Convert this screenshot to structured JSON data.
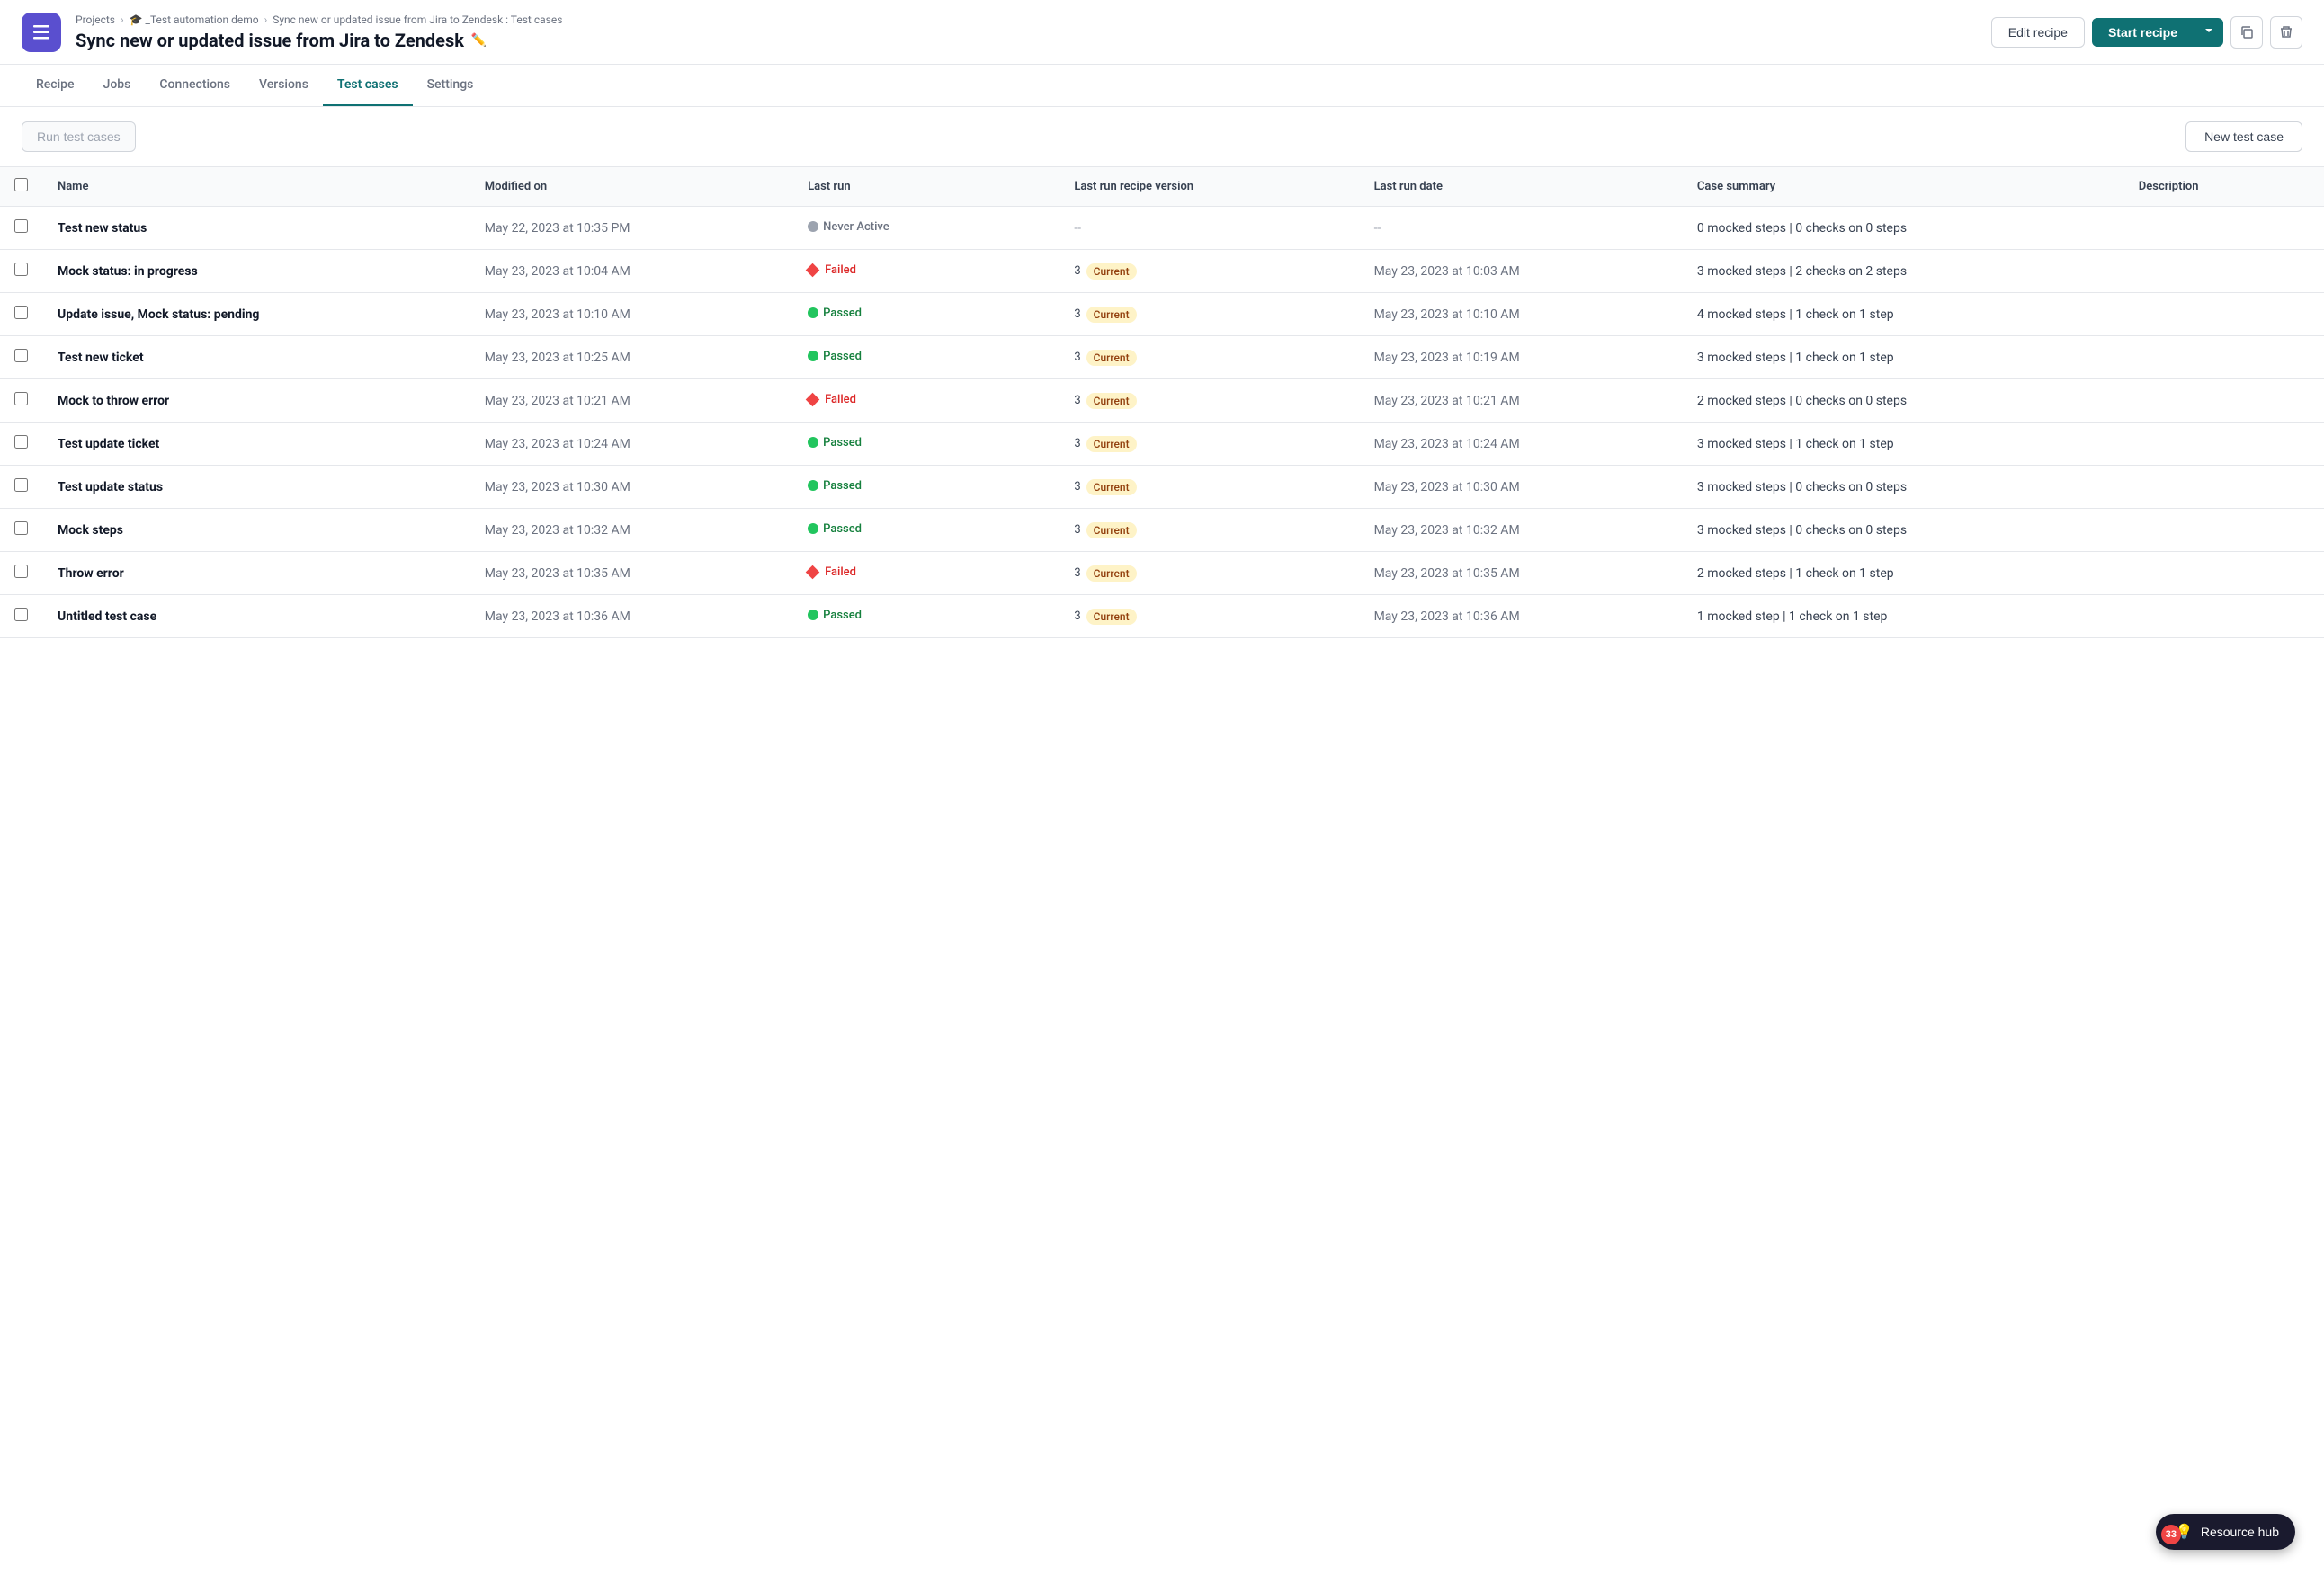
{
  "breadcrumb": {
    "items": [
      "Projects",
      "_Test automation demo",
      "Sync new or updated issue from Jira to Zendesk : Test cases"
    ]
  },
  "header": {
    "title": "Sync new or updated issue from Jira to Zendesk",
    "edit_recipe_label": "Edit recipe",
    "start_recipe_label": "Start recipe"
  },
  "nav": {
    "tabs": [
      "Recipe",
      "Jobs",
      "Connections",
      "Versions",
      "Test cases",
      "Settings"
    ],
    "active": "Test cases"
  },
  "toolbar": {
    "run_test_label": "Run test cases",
    "new_test_label": "New test case"
  },
  "table": {
    "columns": [
      "Name",
      "Modified on",
      "Last run",
      "Last run recipe version",
      "Last run date",
      "Case summary",
      "Description"
    ],
    "rows": [
      {
        "name": "Test new status",
        "modified_on": "May 22, 2023 at 10:35 PM",
        "last_run_status": "never",
        "last_run_label": "Never Active",
        "version_num": "--",
        "version_tag": "",
        "last_run_date": "--",
        "case_summary": "0 mocked steps | 0 checks on 0 steps",
        "description": ""
      },
      {
        "name": "Mock status: in progress",
        "modified_on": "May 23, 2023 at 10:04 AM",
        "last_run_status": "failed",
        "last_run_label": "Failed",
        "version_num": "3",
        "version_tag": "Current",
        "last_run_date": "May 23, 2023 at 10:03 AM",
        "case_summary": "3 mocked steps | 2 checks on 2 steps",
        "description": ""
      },
      {
        "name": "Update issue, Mock status: pending",
        "modified_on": "May 23, 2023 at 10:10 AM",
        "last_run_status": "passed",
        "last_run_label": "Passed",
        "version_num": "3",
        "version_tag": "Current",
        "last_run_date": "May 23, 2023 at 10:10 AM",
        "case_summary": "4 mocked steps | 1 check on 1 step",
        "description": ""
      },
      {
        "name": "Test new ticket",
        "modified_on": "May 23, 2023 at 10:25 AM",
        "last_run_status": "passed",
        "last_run_label": "Passed",
        "version_num": "3",
        "version_tag": "Current",
        "last_run_date": "May 23, 2023 at 10:19 AM",
        "case_summary": "3 mocked steps | 1 check on 1 step",
        "description": ""
      },
      {
        "name": "Mock to throw error",
        "modified_on": "May 23, 2023 at 10:21 AM",
        "last_run_status": "failed",
        "last_run_label": "Failed",
        "version_num": "3",
        "version_tag": "Current",
        "last_run_date": "May 23, 2023 at 10:21 AM",
        "case_summary": "2 mocked steps | 0 checks on 0 steps",
        "description": ""
      },
      {
        "name": "Test update ticket",
        "modified_on": "May 23, 2023 at 10:24 AM",
        "last_run_status": "passed",
        "last_run_label": "Passed",
        "version_num": "3",
        "version_tag": "Current",
        "last_run_date": "May 23, 2023 at 10:24 AM",
        "case_summary": "3 mocked steps | 1 check on 1 step",
        "description": ""
      },
      {
        "name": "Test update status",
        "modified_on": "May 23, 2023 at 10:30 AM",
        "last_run_status": "passed",
        "last_run_label": "Passed",
        "version_num": "3",
        "version_tag": "Current",
        "last_run_date": "May 23, 2023 at 10:30 AM",
        "case_summary": "3 mocked steps | 0 checks on 0 steps",
        "description": ""
      },
      {
        "name": "Mock steps",
        "modified_on": "May 23, 2023 at 10:32 AM",
        "last_run_status": "passed",
        "last_run_label": "Passed",
        "version_num": "3",
        "version_tag": "Current",
        "last_run_date": "May 23, 2023 at 10:32 AM",
        "case_summary": "3 mocked steps | 0 checks on 0 steps",
        "description": ""
      },
      {
        "name": "Throw error",
        "modified_on": "May 23, 2023 at 10:35 AM",
        "last_run_status": "failed",
        "last_run_label": "Failed",
        "version_num": "3",
        "version_tag": "Current",
        "last_run_date": "May 23, 2023 at 10:35 AM",
        "case_summary": "2 mocked steps | 1 check on 1 step",
        "description": ""
      },
      {
        "name": "Untitled test case",
        "modified_on": "May 23, 2023 at 10:36 AM",
        "last_run_status": "passed",
        "last_run_label": "Passed",
        "version_num": "3",
        "version_tag": "Current",
        "last_run_date": "May 23, 2023 at 10:36 AM",
        "case_summary": "1 mocked step | 1 check on 1 step",
        "description": ""
      }
    ]
  },
  "resource_hub": {
    "label": "Resource hub",
    "badge_count": "33"
  }
}
